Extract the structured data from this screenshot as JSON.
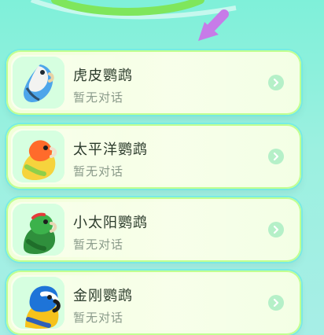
{
  "parrots": [
    {
      "name": "虎皮鹦鹉",
      "status": "暂无对话",
      "icon": "budgerigar-avatar-icon"
    },
    {
      "name": "太平洋鹦鹉",
      "status": "暂无对话",
      "icon": "pacific-parrotlet-avatar-icon"
    },
    {
      "name": "小太阳鹦鹉",
      "status": "暂无对话",
      "icon": "sun-conure-avatar-icon"
    },
    {
      "name": "金刚鹦鹉",
      "status": "暂无对话",
      "icon": "macaw-avatar-icon"
    }
  ],
  "colors": {
    "background": "#9cf0e0",
    "card_fill": "#f6ffe3",
    "card_border": "#beff8c",
    "chevron_badge": "#b5f0c8",
    "title_text": "#2b3a2b",
    "subtitle_text": "#8a9a8a",
    "arrow_accent": "#c77be8"
  }
}
